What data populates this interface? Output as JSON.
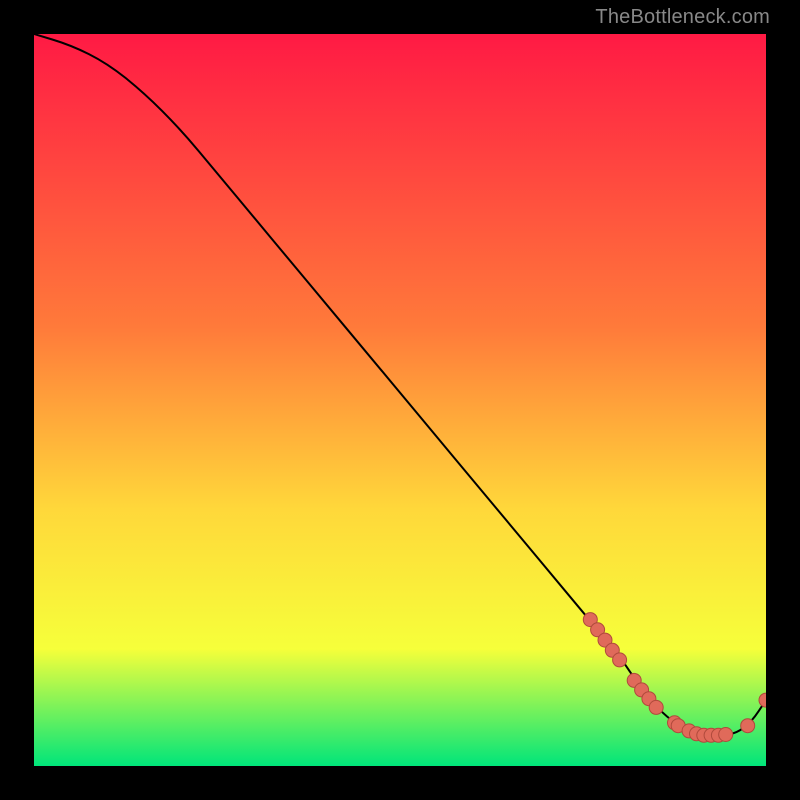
{
  "watermark": "TheBottleneck.com",
  "colors": {
    "gradient_top": "#ff1a44",
    "gradient_mid1": "#ff7a3a",
    "gradient_mid2": "#ffd83a",
    "gradient_mid3": "#f6ff3a",
    "gradient_bottom": "#00e57a",
    "curve": "#000000",
    "marker_fill": "#e06a5a",
    "marker_stroke": "#b04a3c"
  },
  "chart_data": {
    "type": "line",
    "title": "",
    "xlabel": "",
    "ylabel": "",
    "xlim": [
      0,
      100
    ],
    "ylim": [
      0,
      100
    ],
    "grid": false,
    "legend": false,
    "series": [
      {
        "name": "curve",
        "x": [
          0,
          5,
          10,
          15,
          20,
          25,
          30,
          35,
          40,
          45,
          50,
          55,
          60,
          65,
          70,
          75,
          80,
          82,
          85,
          88,
          90,
          92,
          94,
          96,
          98,
          100
        ],
        "y": [
          100,
          98.5,
          96,
          92,
          87,
          81,
          75,
          69,
          63,
          57,
          51,
          45,
          39,
          33,
          27,
          21,
          15,
          12,
          8,
          5.5,
          4.5,
          4.2,
          4.2,
          4.5,
          6,
          9
        ]
      }
    ],
    "markers": [
      {
        "x": 76.0,
        "y": 20.0
      },
      {
        "x": 77.0,
        "y": 18.6
      },
      {
        "x": 78.0,
        "y": 17.2
      },
      {
        "x": 79.0,
        "y": 15.8
      },
      {
        "x": 80.0,
        "y": 14.5
      },
      {
        "x": 82.0,
        "y": 11.7
      },
      {
        "x": 83.0,
        "y": 10.4
      },
      {
        "x": 84.0,
        "y": 9.2
      },
      {
        "x": 85.0,
        "y": 8.0
      },
      {
        "x": 87.5,
        "y": 5.9
      },
      {
        "x": 88.0,
        "y": 5.5
      },
      {
        "x": 89.5,
        "y": 4.8
      },
      {
        "x": 90.5,
        "y": 4.4
      },
      {
        "x": 91.5,
        "y": 4.2
      },
      {
        "x": 92.5,
        "y": 4.2
      },
      {
        "x": 93.5,
        "y": 4.2
      },
      {
        "x": 94.5,
        "y": 4.3
      },
      {
        "x": 97.5,
        "y": 5.5
      },
      {
        "x": 100.0,
        "y": 9.0
      }
    ]
  }
}
